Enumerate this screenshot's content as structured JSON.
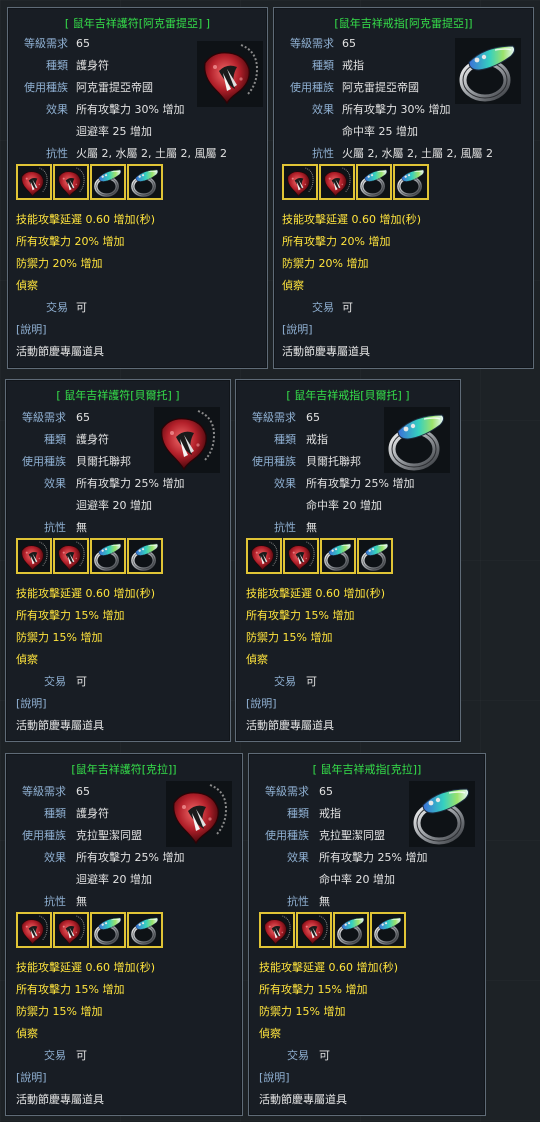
{
  "labels": {
    "level": "等級需求",
    "kind": "種類",
    "race": "使用種族",
    "effect": "效果",
    "resist": "抗性",
    "trade": "交易",
    "explain": "[說明]"
  },
  "cards": [
    {
      "title": "[ 鼠年吉祥護符[阿克雷提亞] ]",
      "level": "65",
      "kind": "護身符",
      "race": "阿克雷提亞帝國",
      "effect1": "所有攻擊力 30% 增加",
      "effect2": "迴避率 25 增加",
      "resist": "火屬 2, 水屬 2, 土屬 2, 風屬 2",
      "bonus1": "技能攻擊延遲 0.60 增加(秒)",
      "bonus2": "所有攻擊力 20% 增加",
      "bonus3": "防禦力 20% 增加",
      "scout": "偵察",
      "trade": "可",
      "note": "活動節慶專屬道具",
      "item_icon": "red-fang-amulet-icon",
      "slot_icons": [
        "red-amulet-slot-icon",
        "red-amulet-slot-icon",
        "silver-ring-slot-icon",
        "silver-ring-slot-icon"
      ]
    },
    {
      "title": "[鼠年吉祥戒指[阿克雷提亞]]",
      "level": "65",
      "kind": "戒指",
      "race": "阿克雷提亞帝國",
      "effect1": "所有攻擊力 30% 增加",
      "effect2": "命中率 25 增加",
      "resist": "火屬 2, 水屬 2, 土屬 2, 風屬 2",
      "bonus1": "技能攻擊延遲 0.60 增加(秒)",
      "bonus2": "所有攻擊力 20% 增加",
      "bonus3": "防禦力 20% 增加",
      "scout": "偵察",
      "trade": "可",
      "note": "活動節慶專屬道具",
      "item_icon": "silver-gem-ring-icon",
      "slot_icons": [
        "red-amulet-slot-icon",
        "red-amulet-slot-icon",
        "silver-ring-slot-icon",
        "silver-ring-slot-icon"
      ]
    },
    {
      "title": "[ 鼠年吉祥護符[貝爾托] ]",
      "level": "65",
      "kind": "護身符",
      "race": "貝爾托聯邦",
      "effect1": "所有攻擊力 25% 增加",
      "effect2": "迴避率 20 增加",
      "resist": "無",
      "bonus1": "技能攻擊延遲 0.60 增加(秒)",
      "bonus2": "所有攻擊力 15% 增加",
      "bonus3": "防禦力 15% 增加",
      "scout": "偵察",
      "trade": "可",
      "note": "活動節慶專屬道具",
      "item_icon": "red-fang-amulet-icon",
      "slot_icons": [
        "red-amulet-slot-icon",
        "red-amulet-slot-icon",
        "silver-ring-slot-icon",
        "silver-ring-slot-icon"
      ]
    },
    {
      "title": "[ 鼠年吉祥戒指[貝爾托] ]",
      "level": "65",
      "kind": "戒指",
      "race": "貝爾托聯邦",
      "effect1": "所有攻擊力 25% 增加",
      "effect2": "命中率 20 增加",
      "resist": "無",
      "bonus1": "技能攻擊延遲 0.60 增加(秒)",
      "bonus2": "所有攻擊力 15% 增加",
      "bonus3": "防禦力 15% 增加",
      "scout": "偵察",
      "trade": "可",
      "note": "活動節慶專屬道具",
      "item_icon": "silver-gem-ring-icon",
      "slot_icons": [
        "red-amulet-slot-icon",
        "red-amulet-slot-icon",
        "silver-ring-slot-icon",
        "silver-ring-slot-icon"
      ]
    },
    {
      "title": "[鼠年吉祥護符[克拉]]",
      "level": "65",
      "kind": "護身符",
      "race": "克拉聖潔同盟",
      "effect1": "所有攻擊力 25% 增加",
      "effect2": "迴避率 20 增加",
      "resist": "無",
      "bonus1": "技能攻擊延遲 0.60 增加(秒)",
      "bonus2": "所有攻擊力 15% 增加",
      "bonus3": "防禦力 15% 增加",
      "scout": "偵察",
      "trade": "可",
      "note": "活動節慶專屬道具",
      "item_icon": "red-fang-amulet-icon",
      "slot_icons": [
        "red-amulet-slot-icon",
        "red-amulet-slot-icon",
        "silver-ring-slot-icon",
        "silver-ring-slot-icon"
      ]
    },
    {
      "title": "[ 鼠年吉祥戒指[克拉]]",
      "level": "65",
      "kind": "戒指",
      "race": "克拉聖潔同盟",
      "effect1": "所有攻擊力 25% 增加",
      "effect2": "命中率 20 增加",
      "resist": "無",
      "bonus1": "技能攻擊延遲 0.60 增加(秒)",
      "bonus2": "所有攻擊力 15% 增加",
      "bonus3": "防禦力 15% 增加",
      "scout": "偵察",
      "trade": "可",
      "note": "活動節慶專屬道具",
      "item_icon": "silver-gem-ring-icon",
      "slot_icons": [
        "red-amulet-slot-icon",
        "red-amulet-slot-icon",
        "silver-ring-slot-icon",
        "silver-ring-slot-icon"
      ]
    }
  ],
  "colors": {
    "title": "#35e04a",
    "label": "#8fb0d2",
    "value": "#e2e2e2",
    "bonus": "#ffe43d",
    "slot_border": "#e0c436",
    "panel_border": "#5f6b77"
  }
}
